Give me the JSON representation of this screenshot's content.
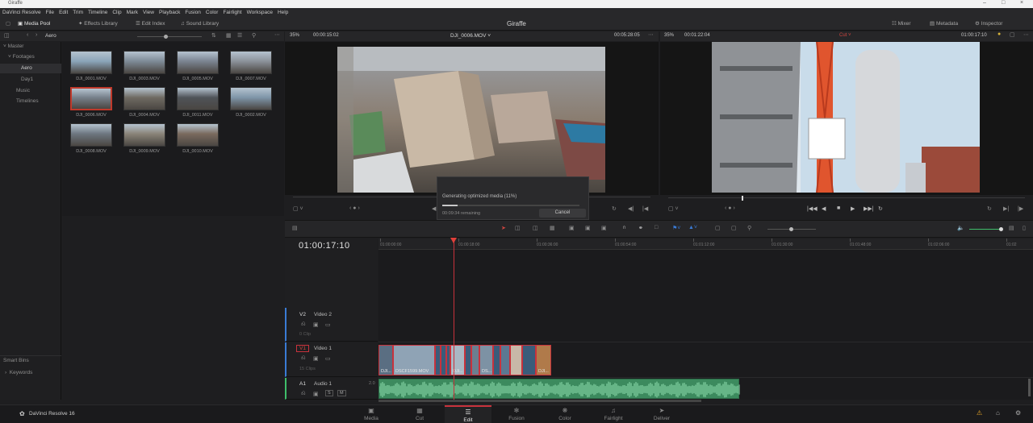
{
  "window": {
    "title": "Giraffe"
  },
  "menu": [
    "DaVinci Resolve",
    "File",
    "Edit",
    "Trim",
    "Timeline",
    "Clip",
    "Mark",
    "View",
    "Playback",
    "Fusion",
    "Color",
    "Fairlight",
    "Workspace",
    "Help"
  ],
  "toolbar": {
    "media_pool": "Media Pool",
    "effects_library": "Effects Library",
    "edit_index": "Edit Index",
    "sound_library": "Sound Library",
    "project_title": "Giraffe",
    "mixer": "Mixer",
    "metadata": "Metadata",
    "inspector": "Inspector"
  },
  "bin_bar": {
    "current_bin": "Aero"
  },
  "bins": {
    "master": "Master",
    "footages": "Footages",
    "aero": "Aero",
    "day1": "Day1",
    "music": "Music",
    "timelines": "Timelines",
    "smart_bins": "Smart Bins",
    "keywords": "Keywords"
  },
  "clips": [
    {
      "name": "DJI_0001.MOV",
      "color": "#8aa4b8"
    },
    {
      "name": "DJI_0003.MOV",
      "color": "#7d8a96"
    },
    {
      "name": "DJI_0005.MOV",
      "color": "#7a8390"
    },
    {
      "name": "DJI_0007.MOV",
      "color": "#8b9199"
    },
    {
      "name": "DJI_0006.MOV",
      "color": "#76808a"
    },
    {
      "name": "DJI_0004.MOV",
      "color": "#6f6a62"
    },
    {
      "name": "DJI_0011.MOV",
      "color": "#4f5358"
    },
    {
      "name": "DJI_0002.MOV",
      "color": "#7e95a8"
    },
    {
      "name": "DJI_0008.MOV",
      "color": "#6d7680"
    },
    {
      "name": "DJI_0009.MOV",
      "color": "#8a8478"
    },
    {
      "name": "DJI_0010.MOV",
      "color": "#7a6a5e"
    }
  ],
  "source_viewer": {
    "zoom": "35%",
    "timecode_in": "00:00:15:02",
    "clip_name": "DJI_0006.MOV",
    "duration": "00:05:28:05"
  },
  "timeline_viewer": {
    "zoom": "35%",
    "timecode": "00:01:22:04",
    "mode": "Cut",
    "current_tc": "01:00:17:10"
  },
  "dialog": {
    "message": "Generating optimized media (11%)",
    "remaining": "00:09:34 remaining",
    "cancel": "Cancel",
    "progress": 0.11
  },
  "timeline": {
    "current_tc": "01:00:17:10",
    "ruler": [
      "01:00:00:00",
      "01:00:18:00",
      "01:00:36:00",
      "01:00:54:00",
      "01:01:12:00",
      "01:01:30:00",
      "01:01:48:00",
      "01:02:06:00",
      "01:02"
    ],
    "v2": {
      "id": "V2",
      "name": "Video 2",
      "count": "0 Clip"
    },
    "v1": {
      "id": "V1",
      "name": "Video 1",
      "count": "15 Clips"
    },
    "a1": {
      "id": "A1",
      "name": "Audio 1",
      "level": "2.0"
    },
    "clip_labels": [
      "DJI...",
      "DSCF1599.MOV",
      "DJI...",
      "DS...",
      "DJI..."
    ]
  },
  "pages": [
    "Media",
    "Cut",
    "Edit",
    "Fusion",
    "Color",
    "Fairlight",
    "Deliver"
  ],
  "app_name": "DaVinci Resolve 16",
  "accent": "#c8323c"
}
